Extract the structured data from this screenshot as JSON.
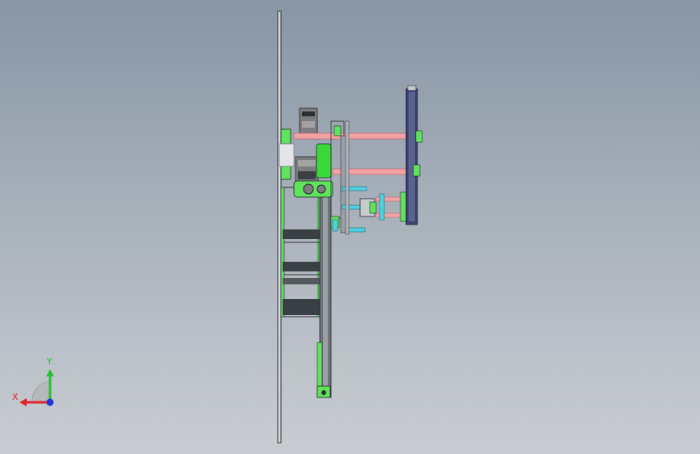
{
  "viewport": {
    "background_top": "#8795a5",
    "background_bottom": "#c9cdd2"
  },
  "triad": {
    "x_label": "X",
    "y_label": "Y",
    "x_color": "#e0232a",
    "y_color": "#23c22d",
    "z_color": "#2037d8"
  },
  "model": {
    "colors": {
      "frame_green": "#5ee35b",
      "rod_pink": "#f2a2a5",
      "cyan": "#4fd0df",
      "chain_navy": "#3c4370",
      "motor_gray": "#7d7d7d",
      "outline": "#20252a"
    }
  }
}
